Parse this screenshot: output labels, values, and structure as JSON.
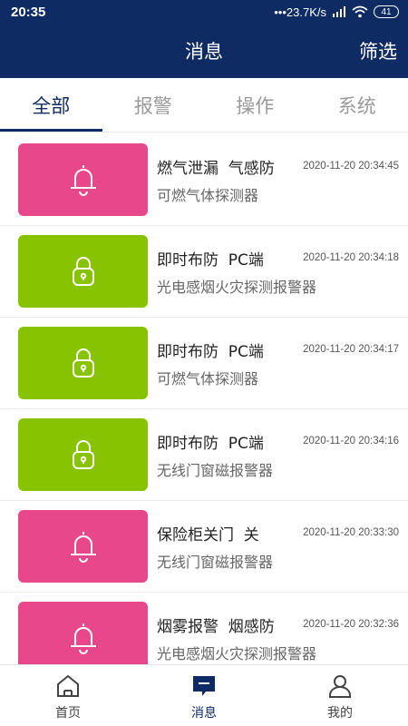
{
  "status_bar": {
    "time": "20:35",
    "network_speed": "•••23.7K/s",
    "battery": "41",
    "signal_icon": "signal-icon",
    "wifi_icon": "wifi-icon"
  },
  "header": {
    "title": "消息",
    "filter_label": "筛选"
  },
  "tabs": [
    {
      "label": "全部",
      "active": true
    },
    {
      "label": "报警",
      "active": false
    },
    {
      "label": "操作",
      "active": false
    },
    {
      "label": "系统",
      "active": false
    }
  ],
  "colors": {
    "brand": "#0e2c63",
    "alarm": "#e8488b",
    "operate": "#88c300"
  },
  "messages": [
    {
      "icon": "bell-icon",
      "kind": "alarm",
      "title": "燃气泄漏  气感防",
      "time": "2020-11-20 20:34:45",
      "device": "可燃气体探测器"
    },
    {
      "icon": "lock-icon",
      "kind": "operate",
      "title": "即时布防  PC端",
      "time": "2020-11-20 20:34:18",
      "device": "光电感烟火灾探测报警器"
    },
    {
      "icon": "lock-icon",
      "kind": "operate",
      "title": "即时布防  PC端",
      "time": "2020-11-20 20:34:17",
      "device": "可燃气体探测器"
    },
    {
      "icon": "lock-icon",
      "kind": "operate",
      "title": "即时布防  PC端",
      "time": "2020-11-20 20:34:16",
      "device": "无线门窗磁报警器"
    },
    {
      "icon": "bell-icon",
      "kind": "alarm",
      "title": "保险柜关门  关",
      "time": "2020-11-20 20:33:30",
      "device": "无线门窗磁报警器"
    },
    {
      "icon": "bell-icon",
      "kind": "alarm",
      "title": "烟雾报警  烟感防",
      "time": "2020-11-20 20:32:36",
      "device": "光电感烟火灾探测报警器"
    }
  ],
  "bottom_nav": [
    {
      "label": "首页",
      "icon": "home-icon",
      "active": false
    },
    {
      "label": "消息",
      "icon": "message-icon",
      "active": true
    },
    {
      "label": "我的",
      "icon": "profile-icon",
      "active": false
    }
  ]
}
